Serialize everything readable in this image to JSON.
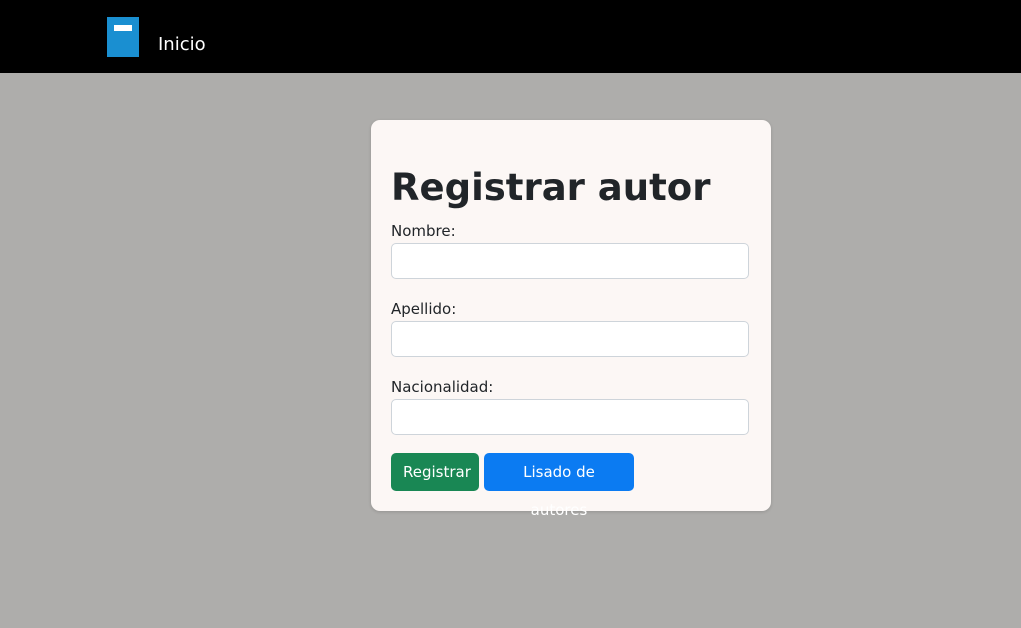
{
  "navbar": {
    "logo_icon": "book-icon",
    "home_label": "Inicio",
    "background": "#000000",
    "logo_color": "#1a8fd1"
  },
  "form": {
    "title": "Registrar autor",
    "fields": [
      {
        "label": "Nombre:",
        "value": "",
        "placeholder": ""
      },
      {
        "label": "Apellido:",
        "value": "",
        "placeholder": ""
      },
      {
        "label": "Nacionalidad:",
        "value": "",
        "placeholder": ""
      }
    ],
    "submit_label": "Registrar",
    "list_label": "Lisado de autores",
    "submit_color": "#198754",
    "list_color": "#0b7bf2"
  },
  "page": {
    "background": "#aeadab",
    "card_background": "#fcf7f5"
  }
}
